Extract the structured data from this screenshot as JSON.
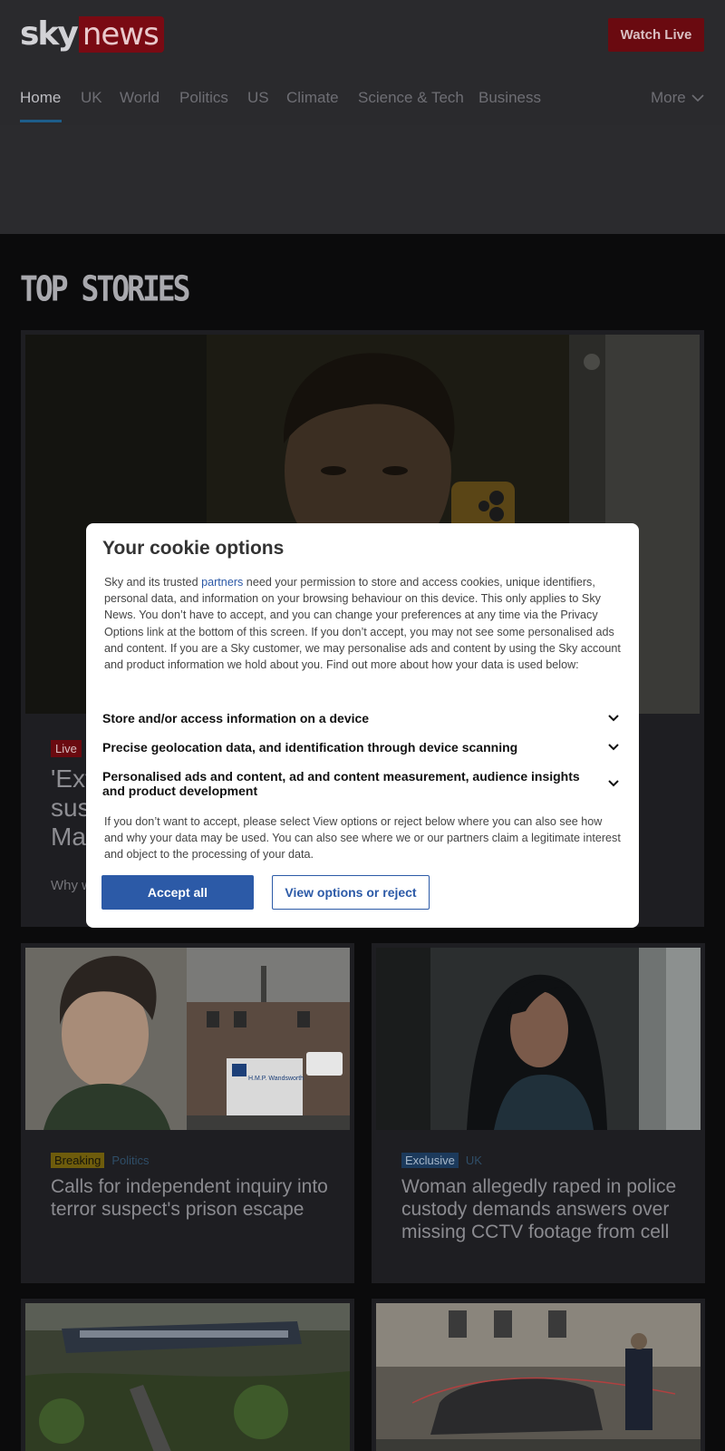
{
  "header": {
    "logo_sky": "sky",
    "logo_news": "news",
    "watch_live": "Watch Live"
  },
  "nav": {
    "items": [
      "Home",
      "UK",
      "World",
      "Politics",
      "US",
      "Climate",
      "Science & Tech",
      "Business"
    ],
    "more": "More",
    "active": "Home"
  },
  "section_title": "TOP STORIES",
  "hero": {
    "badge": "Live",
    "headline": "'Ext… sus… Ma…",
    "headline_lines": [
      "'Ext",
      "sus",
      "Ma"
    ],
    "standfirst": "Why w"
  },
  "cards": [
    {
      "tag": "Breaking",
      "category": "Politics",
      "headline": "Calls for independent inquiry into terror suspect's prison escape",
      "sign_text": "H.M.P. Wandsworth"
    },
    {
      "tag": "Exclusive",
      "category": "UK",
      "headline": "Woman allegedly raped in police custody demands answers over missing CCTV footage from cell"
    }
  ],
  "cookie_modal": {
    "title": "Your cookie options",
    "intro_before_link": "Sky and its trusted ",
    "intro_link": "partners",
    "intro_after_link": " need your permission to store and access cookies, unique identifiers, personal data, and information on your browsing behaviour on this device. This only applies to Sky News. You don’t have to accept, and you can change your preferences at any time via the Privacy Options link at the bottom of this screen. If you don’t accept, you may not see some personalised ads and content.  If you are a Sky customer, we may personalise ads and content by using the Sky account and product information we hold about you. Find out more about how your data is used below:",
    "purposes": [
      "Store and/or access information on a device",
      "Precise geolocation data, and identification through device scanning",
      "Personalised ads and content, ad and content measurement, audience insights and product development"
    ],
    "note": "If you don’t want to accept, please select View options or reject below where you can also see how and why your data may be used. You can also see where we or our partners claim a legitimate interest and object to the processing of your data.",
    "accept_label": "Accept all",
    "options_label": "View options or reject"
  },
  "colors": {
    "brand_red": "#6a0a10",
    "button_blue": "#2c5aa7",
    "breaking_yellow": "#6e5c0c"
  }
}
